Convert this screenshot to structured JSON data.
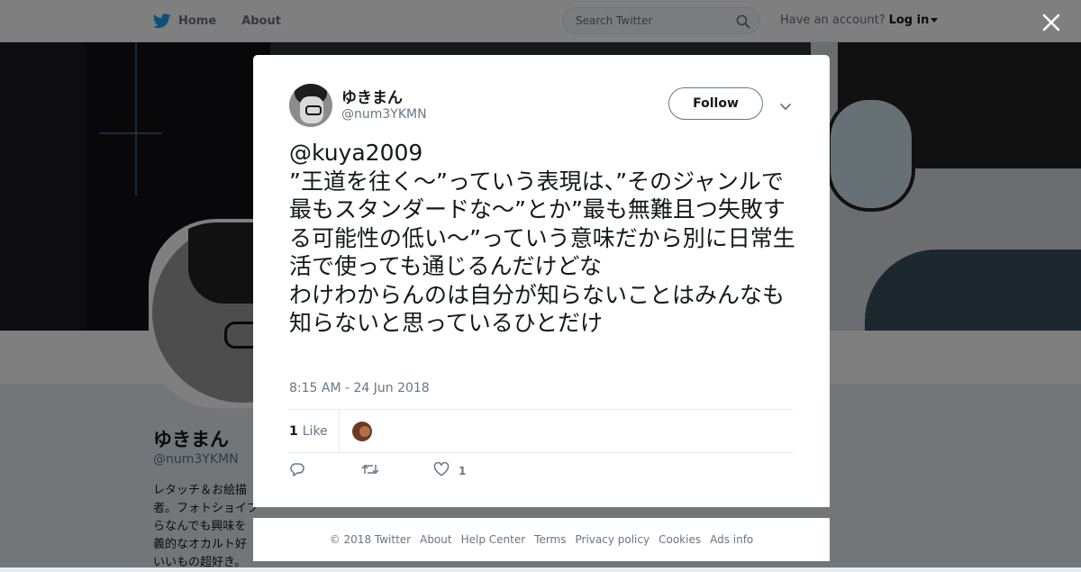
{
  "nav": {
    "home_label": "Home",
    "about_label": "About",
    "search_placeholder": "Search Twitter",
    "account_prompt": "Have an account?",
    "login_label": "Log in"
  },
  "profile": {
    "name": "ゆきまん",
    "handle": "@num3YKMN",
    "bio": "レタッチ＆お絵描\n者。フォトショイブ\nらなんでも興味を\n義的なオカルト好\nいいもの超好き。"
  },
  "tweet": {
    "author_name": "ゆきまん",
    "author_handle": "@num3YKMN",
    "follow_label": "Follow",
    "text": "@kuya2009\n”王道を往く～”っていう表現は、”そのジャンルで最もスタンダードな～”とか”最も無難且つ失敗する可能性の低い～”っていう意味だから別に日常生活で使っても通じるんだけどな\nわけわからんのは自分が知らないことはみんなも知らないと思っているひとだけ",
    "timestamp": "8:15 AM - 24 Jun 2018",
    "likes_count": "1",
    "likes_label": "Like",
    "action_like_count": "1"
  },
  "footer": {
    "links": [
      "© 2018 Twitter",
      "About",
      "Help Center",
      "Terms",
      "Privacy policy",
      "Cookies",
      "Ads info"
    ]
  },
  "colors": {
    "twitter_blue": "#1da1f2",
    "text_primary": "#14171a",
    "text_secondary": "#657786",
    "overlay": "rgba(0,0,0,0.5)"
  },
  "icons": [
    "twitter-bird-icon",
    "search-icon",
    "close-icon",
    "chevron-down-icon",
    "reply-icon",
    "retweet-icon",
    "heart-icon"
  ]
}
